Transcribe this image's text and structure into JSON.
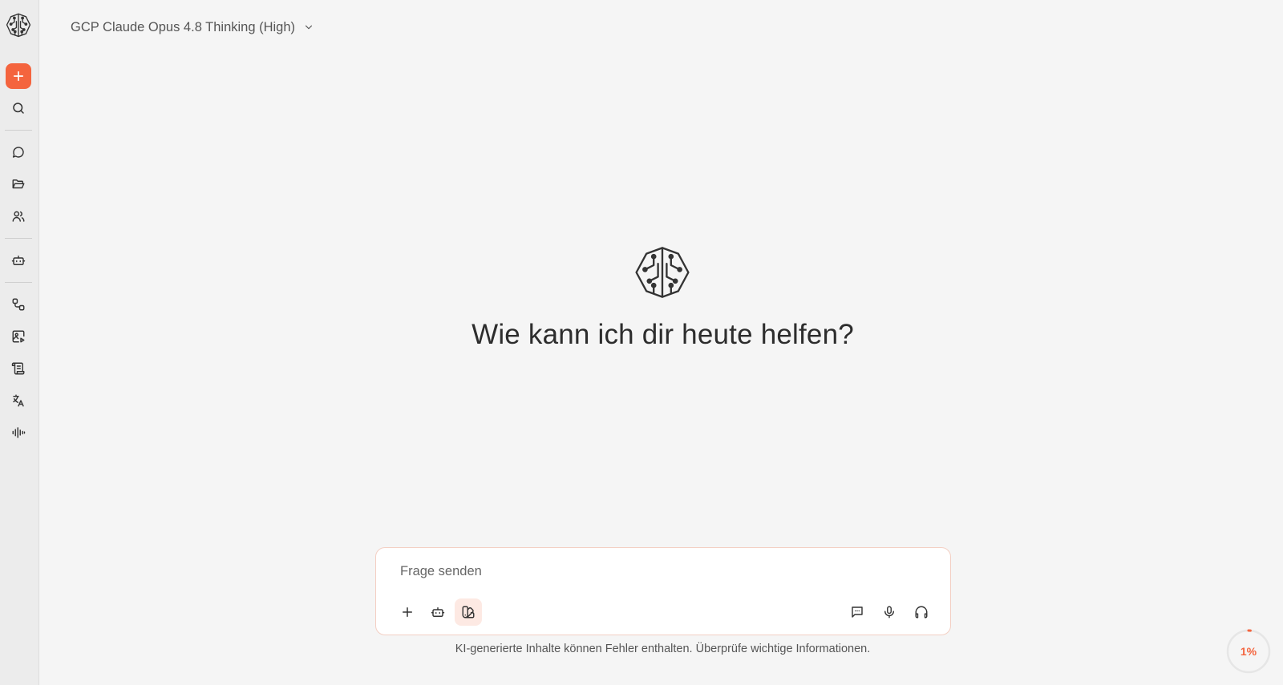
{
  "header": {
    "model_name": "GCP Claude Opus 4.8 Thinking (High)"
  },
  "sidebar": {
    "icons": [
      "brain-logo-icon",
      "plus-icon",
      "search-icon",
      "chat-bubble-icon",
      "folder-open-icon",
      "users-icon",
      "bot-icon",
      "workflow-icon",
      "image-play-icon",
      "scroll-icon",
      "translate-icon",
      "audio-waveform-icon"
    ]
  },
  "main": {
    "greeting": "Wie kann ich dir heute helfen?"
  },
  "composer": {
    "placeholder": "Frage senden",
    "value": ""
  },
  "footer": {
    "disclaimer": "KI-generierte Inhalte können Fehler enthalten. Überprüfe wichtige Informationen."
  },
  "progress": {
    "label": "1%",
    "value": 1
  },
  "colors": {
    "accent": "#f4643e",
    "accent_soft": "#fde9e3",
    "background": "#f5f5f5",
    "sidebar": "#ececec"
  }
}
